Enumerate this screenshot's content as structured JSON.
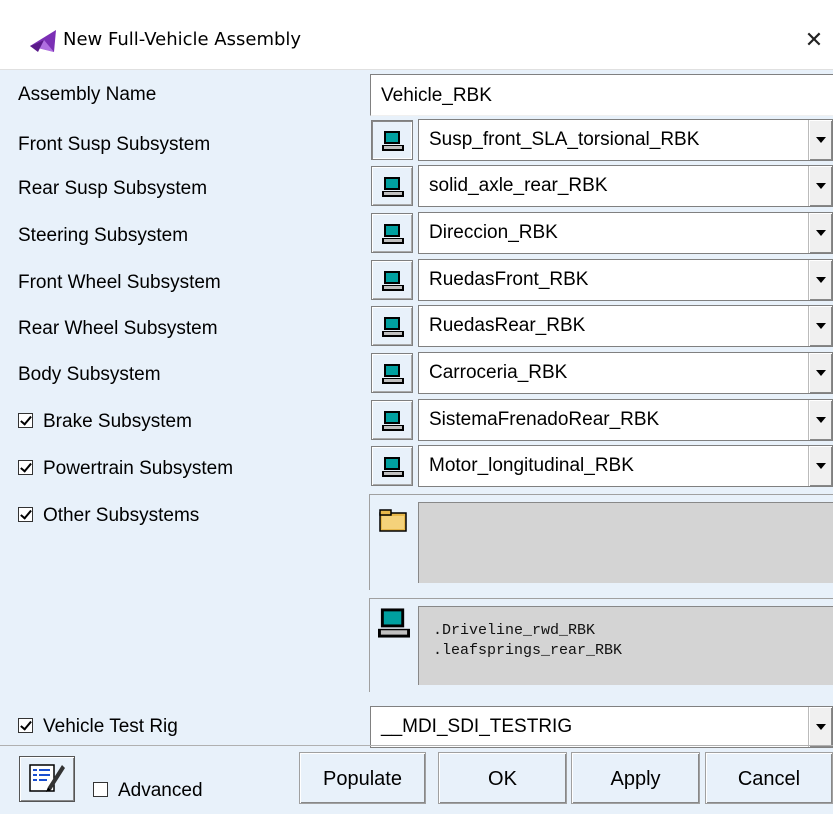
{
  "window": {
    "title": "New Full-Vehicle Assembly",
    "close_glyph": "✕",
    "icon": "adams-car-icon"
  },
  "form": {
    "assembly_name": {
      "label": "Assembly Name",
      "value": "Vehicle_RBK"
    },
    "rows": [
      {
        "label": "Front Susp Subsystem",
        "value": "Susp_front_SLA_torsional_RBK",
        "checkbox": false
      },
      {
        "label": "Rear Susp Subsystem",
        "value": "solid_axle_rear_RBK",
        "checkbox": false
      },
      {
        "label": "Steering Subsystem",
        "value": "Direccion_RBK",
        "checkbox": false
      },
      {
        "label": "Front Wheel Subsystem",
        "value": "RuedasFront_RBK",
        "checkbox": false
      },
      {
        "label": "Rear Wheel Subsystem",
        "value": "RuedasRear_RBK",
        "checkbox": false
      },
      {
        "label": "Body Subsystem",
        "value": "Carroceria_RBK",
        "checkbox": false
      },
      {
        "label": "Brake Subsystem",
        "value": "SistemaFrenadoRear_RBK",
        "checkbox": true,
        "checked": true
      },
      {
        "label": "Powertrain Subsystem",
        "value": "Motor_longitudinal_RBK",
        "checkbox": true,
        "checked": true
      }
    ],
    "other_subsystems": {
      "label": "Other Subsystems",
      "checked": true,
      "file_list": [],
      "database_list": [
        ".Driveline_rwd_RBK",
        ".leafsprings_rear_RBK"
      ]
    },
    "test_rig": {
      "label": "Vehicle Test Rig",
      "checked": true,
      "value": "__MDI_SDI_TESTRIG"
    }
  },
  "footer": {
    "advanced_label": "Advanced",
    "advanced_checked": false,
    "buttons": {
      "populate": "Populate",
      "ok": "OK",
      "apply": "Apply",
      "cancel": "Cancel"
    }
  }
}
